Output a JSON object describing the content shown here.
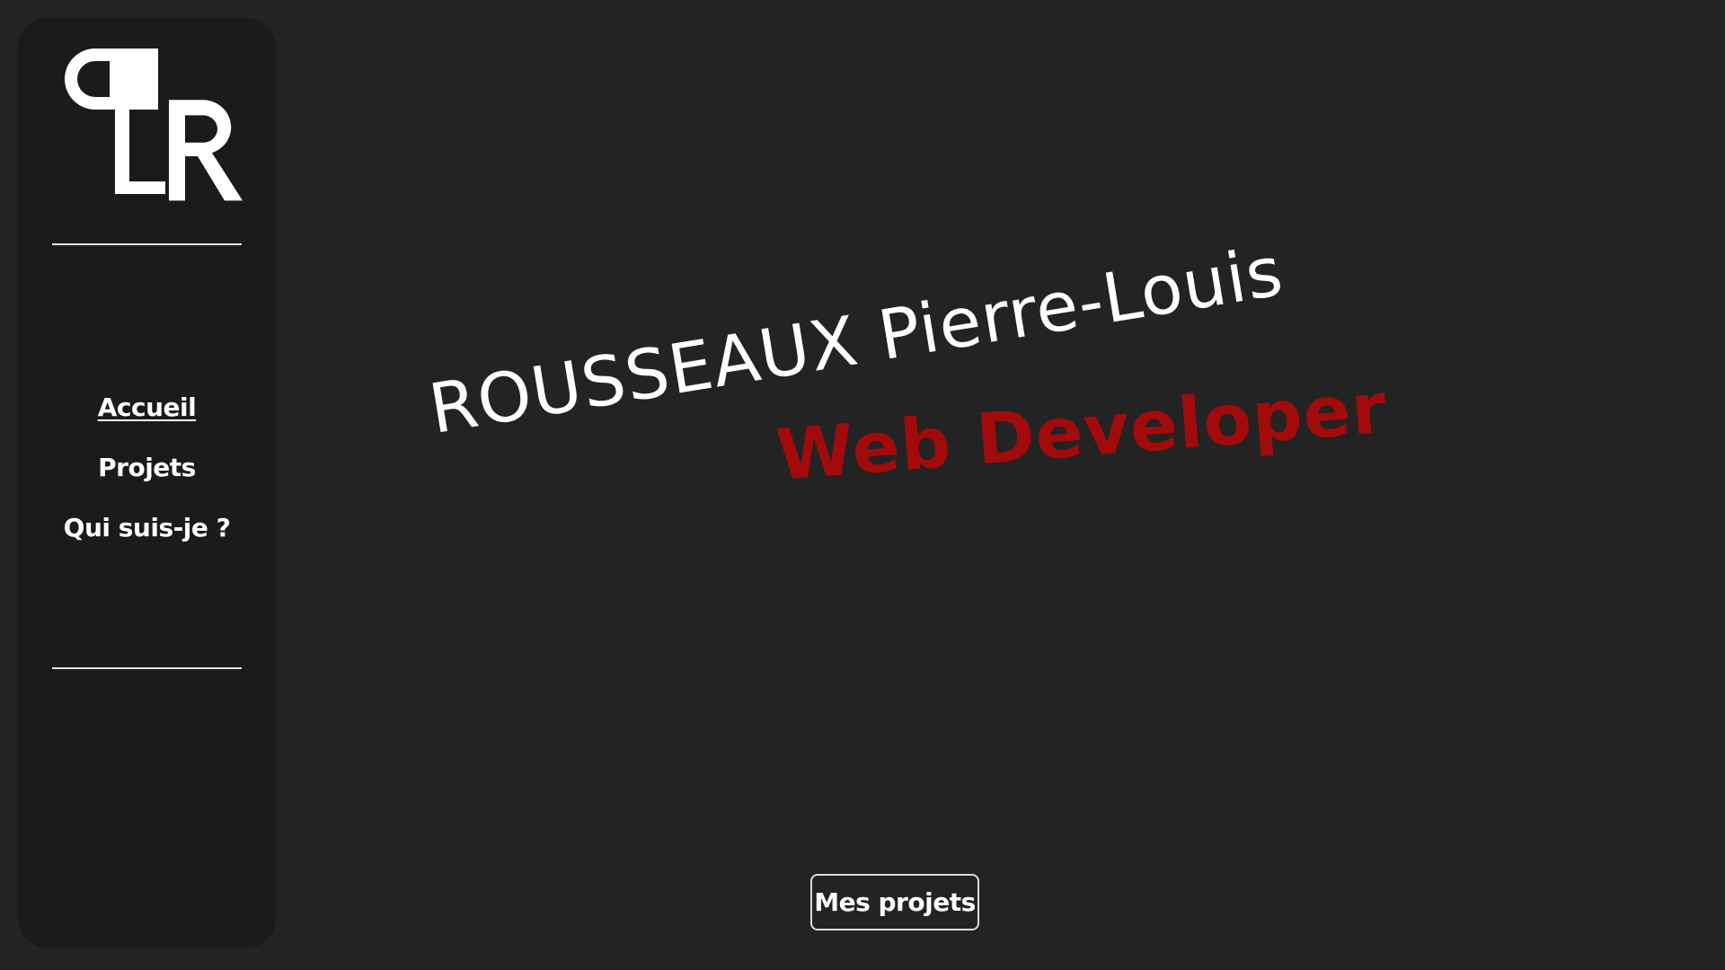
{
  "logo": {
    "icon": "pl-monogram-logo-icon",
    "color": "#ffffff"
  },
  "nav": {
    "items": [
      {
        "label": "Accueil",
        "active": true
      },
      {
        "label": "Projets",
        "active": false
      },
      {
        "label": "Qui suis-je ?",
        "active": false
      }
    ]
  },
  "hero": {
    "name": "ROUSSEAUX Pierre-Louis",
    "role": "Web Developer",
    "role_color": "#a10b0b"
  },
  "cta": {
    "label": "Mes projets"
  },
  "colors": {
    "background": "#232323",
    "sidebar": "#1b1b1b",
    "text": "#ffffff",
    "accent": "#a10b0b"
  }
}
